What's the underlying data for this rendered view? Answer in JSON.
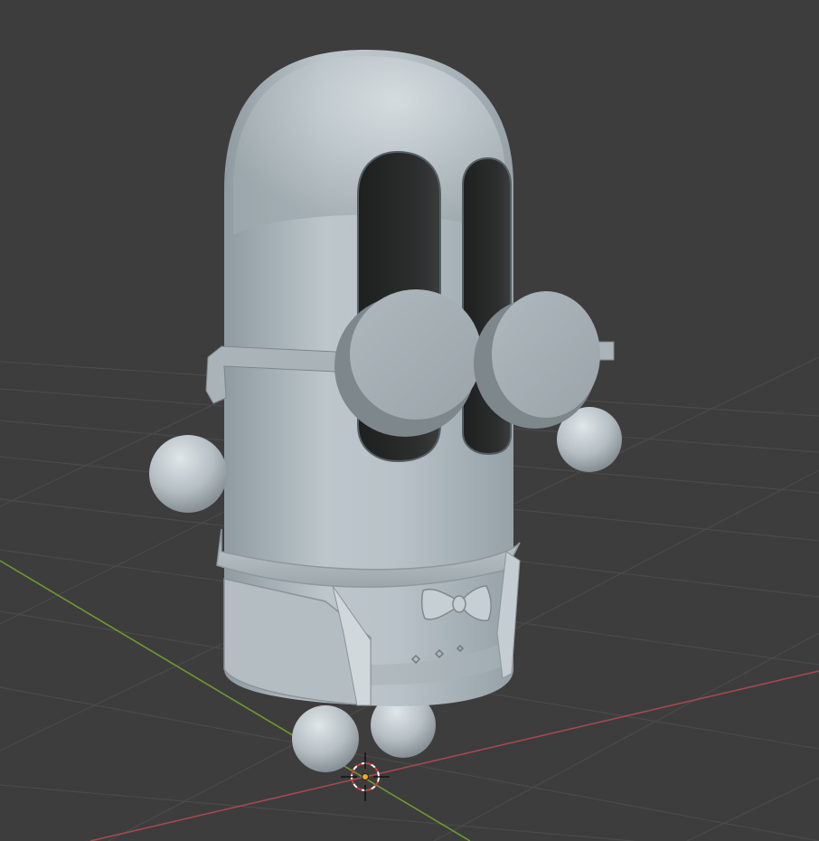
{
  "app": "3D viewport",
  "viewport": {
    "background": "#3d3d3d",
    "grid_color": "#4a4a4a",
    "x_axis_color": "#a44a4f",
    "y_axis_color": "#6e9a2c",
    "cursor_icon": "3d-cursor-icon",
    "origin_icon": "object-origin-icon",
    "origin_color": "#f5a623"
  },
  "model": {
    "parts": [
      "body",
      "left-eye",
      "right-eye",
      "glasses-frame",
      "glasses-lens-left",
      "glasses-lens-right",
      "left-hand",
      "right-hand",
      "collar",
      "bowtie",
      "belt",
      "jacket-flap",
      "left-foot",
      "right-foot"
    ]
  }
}
